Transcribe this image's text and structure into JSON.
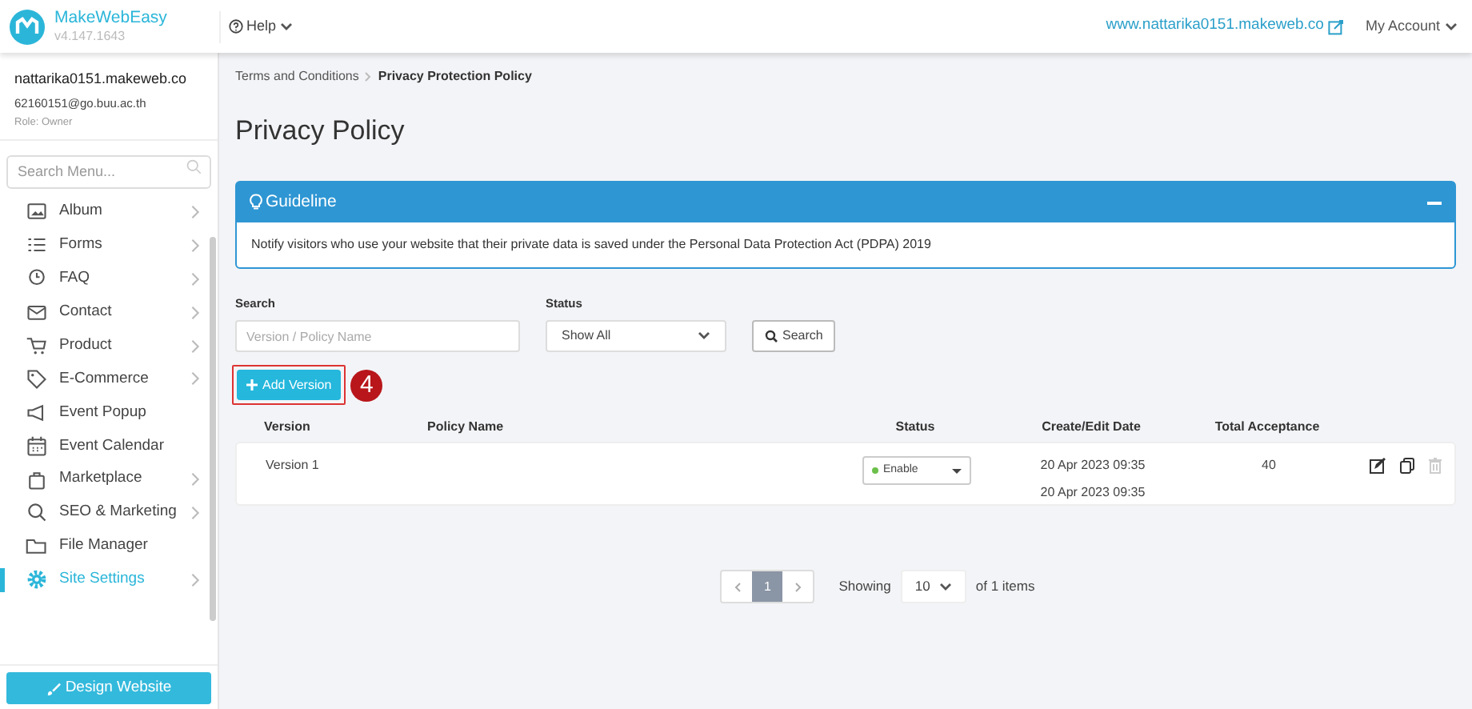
{
  "app": {
    "name": "MakeWebEasy",
    "version": "v4.147.1643"
  },
  "topbar": {
    "help": "Help",
    "site_link": "www.nattarika0151.makeweb.co",
    "account": "My Account"
  },
  "user": {
    "site": "nattarika0151.makeweb.co",
    "email": "62160151@go.buu.ac.th",
    "role": "Role: Owner"
  },
  "sidebar": {
    "search_placeholder": "Search Menu...",
    "items": [
      {
        "kind": "album",
        "label": "Album",
        "arrow": true,
        "selected": false
      },
      {
        "kind": "forms",
        "label": "Forms",
        "arrow": true,
        "selected": false
      },
      {
        "kind": "faq",
        "label": "FAQ",
        "arrow": true,
        "selected": false
      },
      {
        "kind": "contact",
        "label": "Contact",
        "arrow": true,
        "selected": false
      },
      {
        "kind": "product",
        "label": "Product",
        "arrow": true,
        "selected": false
      },
      {
        "kind": "tag",
        "label": "E-Commerce",
        "arrow": true,
        "selected": false
      },
      {
        "kind": "popup",
        "label": "Event Popup",
        "arrow": false,
        "selected": false
      },
      {
        "kind": "calendar",
        "label": "Event Calendar",
        "arrow": false,
        "selected": false
      },
      {
        "kind": "bag",
        "label": "Marketplace",
        "arrow": true,
        "selected": false
      },
      {
        "kind": "search",
        "label": "SEO & Marketing",
        "arrow": true,
        "selected": false
      },
      {
        "kind": "folder",
        "label": "File Manager",
        "arrow": false,
        "selected": false
      },
      {
        "kind": "gear",
        "label": "Site Settings",
        "arrow": true,
        "selected": true
      }
    ],
    "design_button": "Design Website"
  },
  "breadcrumb": [
    {
      "label": "Terms and Conditions",
      "current": false
    },
    {
      "label": "Privacy Protection Policy",
      "current": true
    }
  ],
  "page_title": "Privacy Policy",
  "guideline": {
    "title": "Guideline",
    "text": "Notify visitors who use your website that their private data is saved under the Personal Data Protection Act (PDPA) 2019"
  },
  "filters": {
    "search_label": "Search",
    "search_placeholder": "Version / Policy Name",
    "status_label": "Status",
    "status_value": "Show All",
    "search_button": "Search"
  },
  "add_button": "Add Version",
  "annotation": "4",
  "table": {
    "columns": [
      "Version",
      "Policy Name",
      "Status",
      "Create/Edit Date",
      "Total Acceptance"
    ],
    "rows": [
      {
        "version": "Version 1",
        "status": "Enable",
        "enabled": true,
        "created": "20 Apr 2023 09:35",
        "edited": "20 Apr 2023 09:35",
        "acceptance": "40"
      }
    ]
  },
  "pagination": {
    "pages": [
      {
        "label": "1",
        "selected": true
      }
    ],
    "showing": "Showing",
    "per_page": "10",
    "total": "of 1 items"
  }
}
